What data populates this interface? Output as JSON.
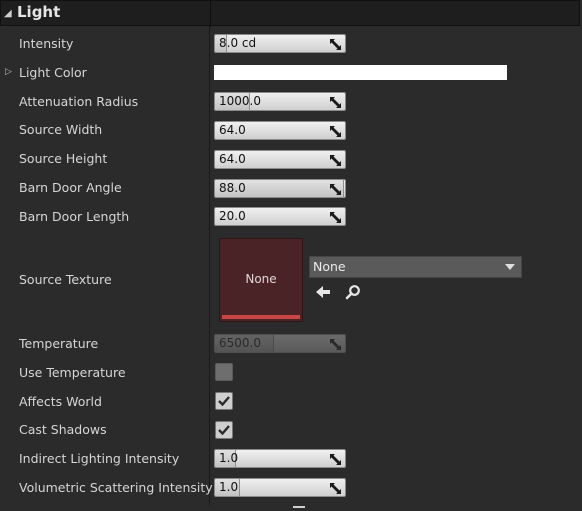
{
  "header": {
    "title": "Light"
  },
  "properties": {
    "intensity": {
      "label": "Intensity",
      "value": "8.0 cd"
    },
    "light_color": {
      "label": "Light Color",
      "color": "#ffffff"
    },
    "attenuation": {
      "label": "Attenuation Radius",
      "value": "1000.0"
    },
    "source_width": {
      "label": "Source Width",
      "value": "64.0"
    },
    "source_height": {
      "label": "Source Height",
      "value": "64.0"
    },
    "barn_door_angle": {
      "label": "Barn Door Angle",
      "value": "88.0"
    },
    "barn_door_length": {
      "label": "Barn Door Length",
      "value": "20.0"
    },
    "source_texture": {
      "label": "Source Texture",
      "thumb_label": "None",
      "dropdown_value": "None"
    },
    "temperature": {
      "label": "Temperature",
      "value": "6500.0"
    },
    "use_temperature": {
      "label": "Use Temperature",
      "checked": false
    },
    "affects_world": {
      "label": "Affects World",
      "checked": true
    },
    "cast_shadows": {
      "label": "Cast Shadows",
      "checked": true
    },
    "indirect": {
      "label": "Indirect Lighting Intensity",
      "value": "1.0"
    },
    "volumetric": {
      "label": "Volumetric Scattering Intensity",
      "value": "1.0"
    }
  },
  "icons": {
    "collapse": "triangle-down-icon",
    "expand": "triangle-right-icon",
    "numeric_drag": "resize-arrows-icon",
    "use_asset": "back-arrow-icon",
    "browse": "search-icon",
    "check": "checkmark-icon"
  },
  "colors": {
    "texture_background": "#4a2327",
    "texture_strip": "#c84646"
  }
}
